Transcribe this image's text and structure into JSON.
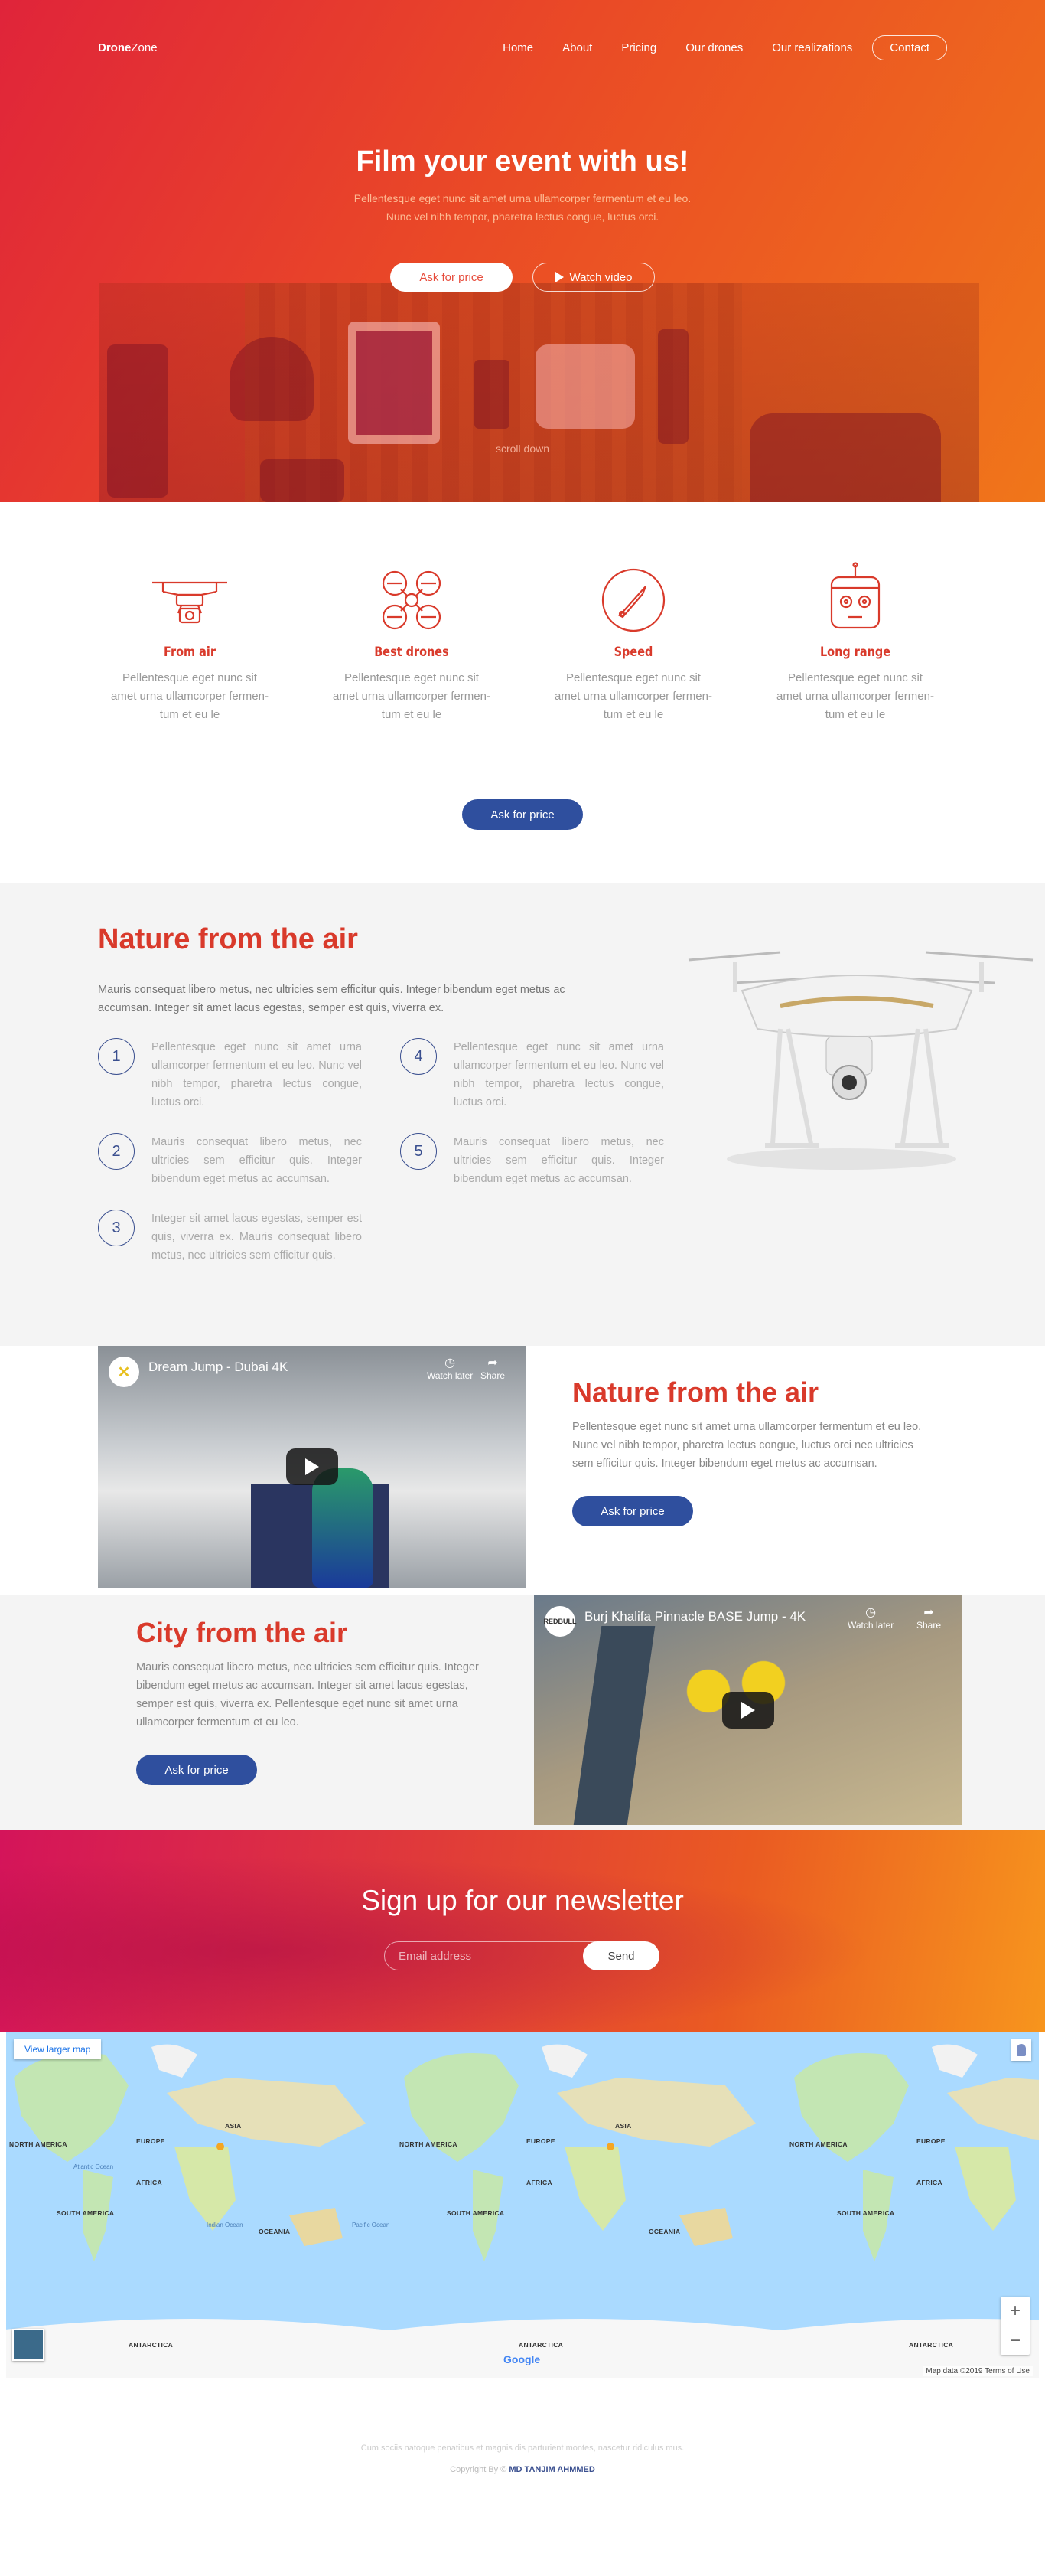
{
  "nav": {
    "brand_bold": "Drone",
    "brand_rest": "Zone",
    "items": [
      "Home",
      "About",
      "Pricing",
      "Our drones",
      "Our realizations"
    ],
    "contact": "Contact"
  },
  "hero": {
    "title": "Film your event with us!",
    "sub1": "Pellentesque eget nunc sit amet urna ullamcorper fermentum et eu leo.",
    "sub2": "Nunc vel nibh tempor, pharetra lectus congue, luctus orci.",
    "btn_price": "Ask for price",
    "btn_video": "Watch video",
    "scroll": "scroll down"
  },
  "features": {
    "items": [
      {
        "title": "From air",
        "text": "Pellentesque eget nunc sit amet urna ullamcorper fermen-tum et eu le",
        "icon": "drone-camera-icon"
      },
      {
        "title": "Best drones",
        "text": "Pellentesque eget nunc sit amet urna ullamcorper fermen-tum et eu le",
        "icon": "quadcopter-icon"
      },
      {
        "title": "Speed",
        "text": "Pellentesque eget nunc sit amet urna ullamcorper fermen-tum et eu le",
        "icon": "speed-gauge-icon"
      },
      {
        "title": "Long range",
        "text": "Pellentesque eget nunc sit amet urna ullamcorper fermen-tum et eu le",
        "icon": "remote-controller-icon"
      }
    ],
    "button": "Ask for price"
  },
  "nature": {
    "title": "Nature from the air",
    "lead": "Mauris consequat libero metus, nec ultricies sem efficitur quis. Integer bibendum eget metus ac accumsan. Integer sit amet lacus egestas, semper est quis, viverra ex.",
    "steps": [
      {
        "num": "1",
        "text": "Pellentesque eget nunc sit amet urna ullamcorper fermentum et eu leo. Nunc vel nibh tempor, pharetra lectus congue, luctus orci."
      },
      {
        "num": "4",
        "text": "Pellentesque eget nunc sit amet urna ullamcorper fermentum et eu leo. Nunc vel nibh tempor, pharetra lectus congue, luctus orci."
      },
      {
        "num": "2",
        "text": "Mauris consequat libero metus, nec ultricies sem efficitur quis. Integer bibendum eget metus ac accumsan."
      },
      {
        "num": "5",
        "text": "Mauris consequat libero metus, nec ultricies sem efficitur quis. Integer bibendum eget metus ac accumsan."
      },
      {
        "num": "3",
        "text": "Integer sit amet lacus egestas, semper est quis, viverra ex. Mauris consequat libero metus, nec ultricies sem efficitur quis."
      }
    ]
  },
  "video1": {
    "video_title": "Dream Jump - Dubai 4K",
    "watch_later": "Watch later",
    "share": "Share",
    "title": "Nature from the air",
    "text": "Pellentesque eget nunc sit amet urna ullamcorper fermentum et eu leo. Nunc vel nibh tempor, pharetra lectus congue, luctus orci nec ultricies sem efficitur quis. Integer bibendum eget metus ac accumsan.",
    "button": "Ask for price"
  },
  "video2": {
    "video_title": "Burj Khalifa Pinnacle BASE Jump - 4K",
    "watch_later": "Watch later",
    "share": "Share",
    "title": "City from the air",
    "text": "Mauris consequat libero metus, nec ultricies sem efficitur quis. Integer bibendum eget metus ac accumsan. Integer sit amet lacus egestas, semper est quis, viverra ex. Pellentesque eget nunc sit amet urna ullamcorper fermentum et eu leo.",
    "button": "Ask for price"
  },
  "newsletter": {
    "title": "Sign up for our newsletter",
    "placeholder": "Email address",
    "button": "Send"
  },
  "map": {
    "larger": "View larger map",
    "google": "Google",
    "attribution": "Map data ©2019     Terms of Use",
    "labels": [
      "NORTH AMERICA",
      "EUROPE",
      "ASIA",
      "AFRICA",
      "SOUTH AMERICA",
      "OCEANIA",
      "ANTARCTICA"
    ],
    "oceans": [
      "Atlantic Ocean",
      "Indian Ocean",
      "Pacific Ocean"
    ]
  },
  "footer": {
    "line1": "Cum sociis natoque penatibus et magnis dis parturient montes, nascetur ridiculus mus.",
    "copyright": "Copyright By © ",
    "author": "MD TANJIM AHMMED"
  },
  "colors": {
    "accent": "#d93a2b",
    "button_blue": "#2f4f9e",
    "hero_start": "#e0243a",
    "hero_end": "#f0761a"
  }
}
